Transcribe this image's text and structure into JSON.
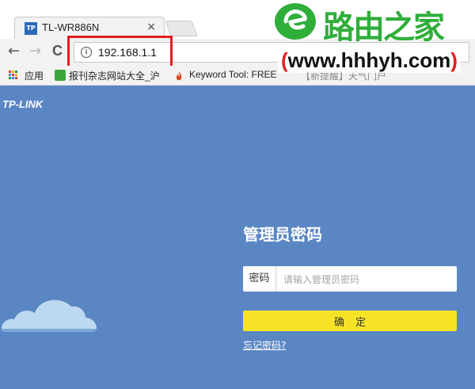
{
  "browser": {
    "tab": {
      "favicon_text": "TP",
      "title": "TL-WR886N",
      "close": "×"
    },
    "toolbar": {
      "back": "←",
      "forward": "→",
      "reload": "C",
      "url": "192.168.1.1"
    },
    "bookmarks": [
      {
        "label": "应用"
      },
      {
        "label": "报刊杂志网站大全_沪"
      },
      {
        "label": "Keyword Tool: FREE"
      },
      {
        "label": "【新提醒】天气门户"
      }
    ]
  },
  "watermark": {
    "brand": "路由之家",
    "url_open": "(",
    "url": "www.hhhyh.com",
    "url_close": ")"
  },
  "page": {
    "brand": "TP-LINK",
    "login": {
      "title": "管理员密码",
      "password_label": "密码",
      "password_placeholder": "请输入管理员密码",
      "confirm_label": "确定",
      "forgot_link": "忘记密码?"
    }
  },
  "colors": {
    "page_bg": "#5b86c4",
    "confirm_bg": "#f7e326",
    "highlight": "#e31d1d",
    "watermark_green": "#2fae3a"
  }
}
